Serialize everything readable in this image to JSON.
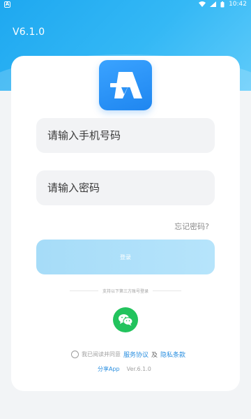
{
  "status_bar": {
    "time": "10:42",
    "left_icon": "a-notification-icon",
    "icons": [
      "wifi-icon",
      "signal-icon",
      "battery-icon"
    ]
  },
  "header": {
    "version": "V6.1.0"
  },
  "login": {
    "phone_placeholder": "请输入手机号码",
    "password_placeholder": "请输入密码",
    "forgot_label": "忘记密码?",
    "login_label": "登录",
    "third_party_label": "支持以下第三方账号登录"
  },
  "agreement": {
    "prefix": "我已阅读并同意",
    "service_link": "服务协议",
    "and": "及",
    "privacy_link": "隐私条款"
  },
  "footer": {
    "app_name": "分享App",
    "version": "Ver.6.1.0"
  },
  "colors": {
    "primary": "#1ea8f0",
    "button_disabled": "#a6dcf8",
    "wechat": "#22c35d",
    "link": "#2a8fe0"
  }
}
